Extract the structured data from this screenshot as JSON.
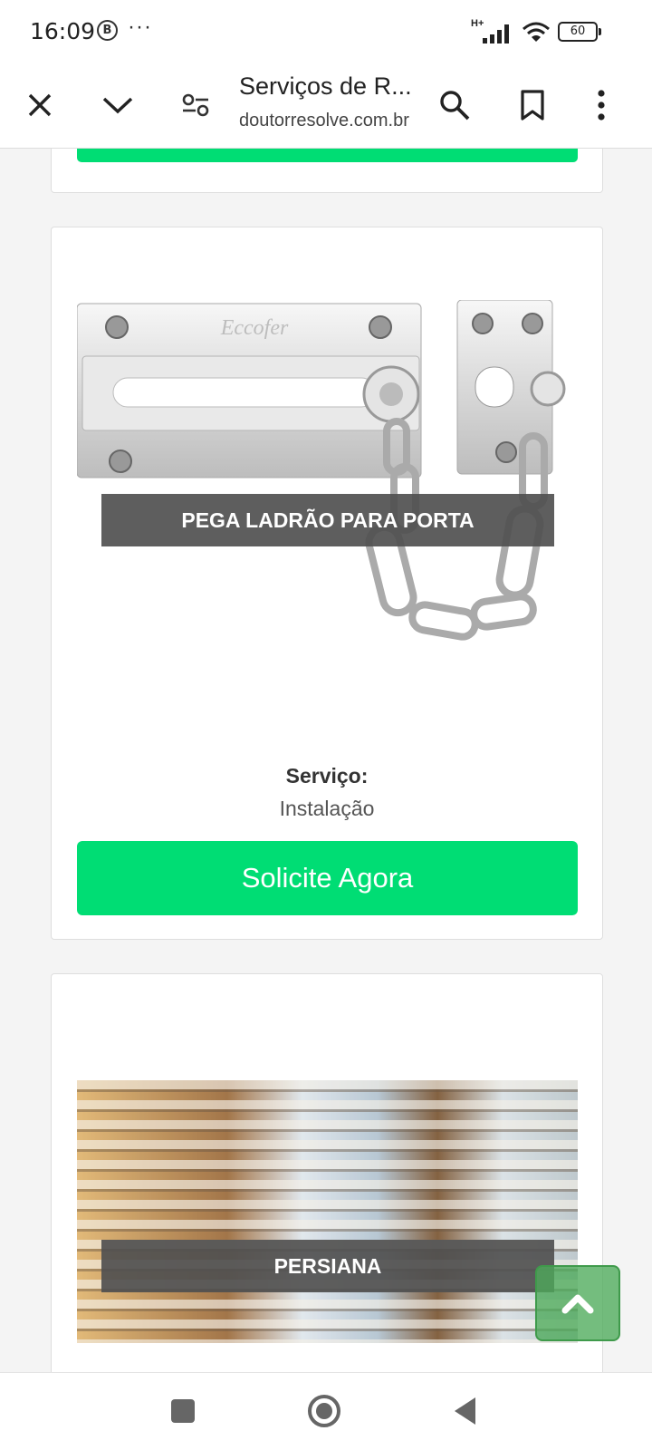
{
  "status_bar": {
    "time": "16:09",
    "notification_badge": "B",
    "more_dots": "···",
    "network_type": "H+",
    "battery_level": "60"
  },
  "browser": {
    "title": "Serviços de R...",
    "url": "doutorresolve.com.br",
    "icons": [
      "close-icon",
      "chevron-down-icon",
      "site-settings-icon",
      "search-icon",
      "bookmark-icon",
      "more-vert-icon"
    ]
  },
  "cards": [
    {
      "caption": "PEGA LADRÃO PARA PORTA",
      "image_brand_text": "Eccofer",
      "service_label": "Serviço:",
      "service_value": "Instalação",
      "cta_label": "Solicite Agora"
    },
    {
      "caption": "PERSIANA"
    }
  ],
  "scroll_top": {
    "icon": "chevron-up-icon"
  },
  "navbar": {
    "icons": [
      "recents-square-icon",
      "home-circle-icon",
      "back-triangle-icon"
    ]
  },
  "colors": {
    "accent_green": "#00dd74",
    "scroll_button": "#4daa5a"
  }
}
